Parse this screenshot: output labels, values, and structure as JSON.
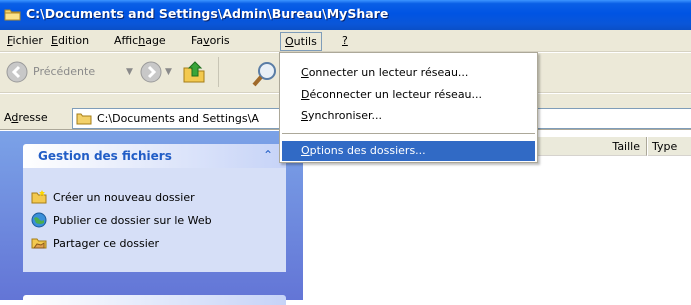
{
  "window": {
    "title": "C:\\Documents and Settings\\Admin\\Bureau\\MyShare"
  },
  "menubar": {
    "items": [
      {
        "pre": "",
        "u": "F",
        "post": "ichier"
      },
      {
        "pre": "",
        "u": "E",
        "post": "dition"
      },
      {
        "pre": "Affic",
        "u": "h",
        "post": "age"
      },
      {
        "pre": "Fa",
        "u": "v",
        "post": "oris"
      },
      {
        "pre": "",
        "u": "O",
        "post": "utils"
      },
      {
        "pre": "",
        "u": "?",
        "post": ""
      }
    ]
  },
  "toolbar": {
    "back_label": "Précédente"
  },
  "address": {
    "label_pre": "A",
    "label_u": "d",
    "label_post": "resse",
    "value": "C:\\Documents and Settings\\A"
  },
  "tasks": {
    "header": "Gestion des fichiers",
    "items": [
      {
        "label": "Créer un nouveau dossier",
        "icon": "new-folder-icon"
      },
      {
        "label": "Publier ce dossier sur le Web",
        "icon": "publish-web-icon"
      },
      {
        "label": "Partager ce dossier",
        "icon": "share-folder-icon"
      }
    ]
  },
  "filelist": {
    "columns": [
      "Taille",
      "Type"
    ]
  },
  "dropdown": {
    "items": [
      {
        "u": "C",
        "post": "onnecter un lecteur réseau..."
      },
      {
        "u": "D",
        "post": "éconnecter un lecteur réseau..."
      },
      {
        "u": "S",
        "post": "ynchroniser..."
      },
      {
        "u": "O",
        "post": "ptions des dossiers..."
      }
    ]
  },
  "colors": {
    "titlebar": "#0054e3",
    "chrome": "#ece9d8",
    "taskpane": "#6b85dc",
    "selection": "#316ac5"
  }
}
